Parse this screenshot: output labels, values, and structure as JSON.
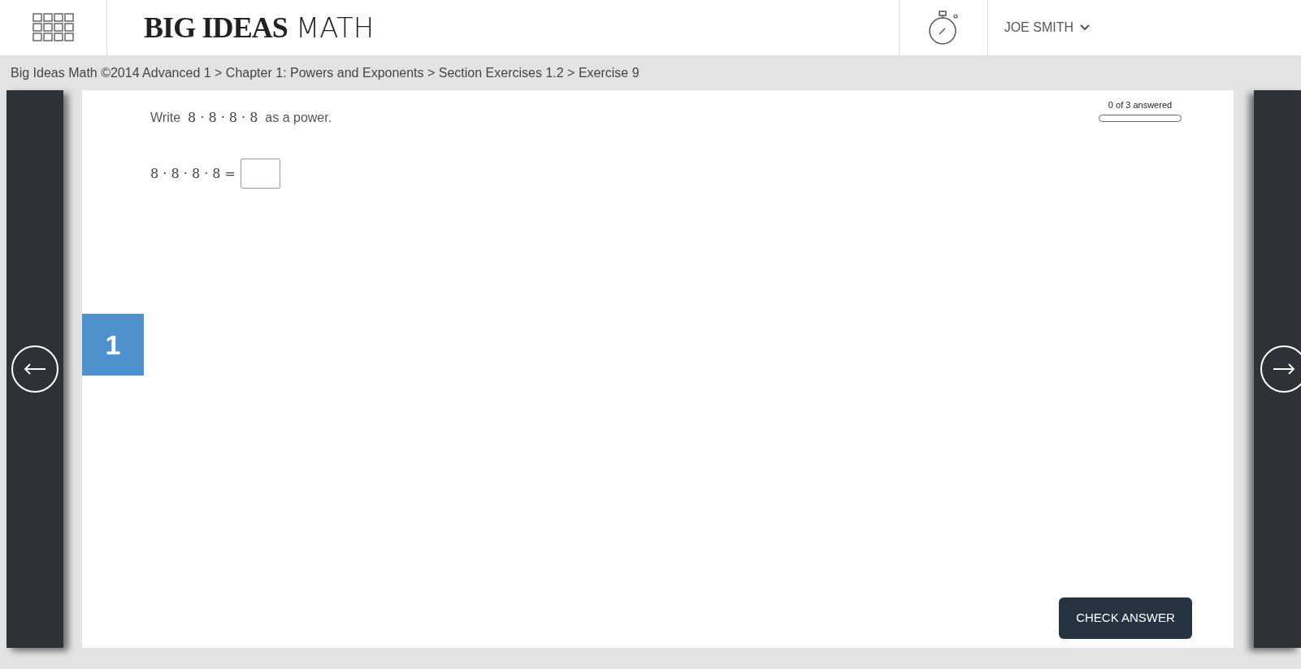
{
  "header": {
    "logo": {
      "bold": "BIG IDEAS",
      "light": "MATH"
    },
    "user": "JOE SMITH"
  },
  "breadcrumb": "Big Ideas Math ©2014 Advanced 1 > Chapter 1: Powers and Exponents > Section Exercises 1.2 > Exercise 9",
  "question": {
    "number": "1",
    "prompt_before": "Write",
    "expression": "8 · 8 · 8 · 8",
    "prompt_after": "as a power.",
    "equation": "8 · 8 · 8 · 8 ="
  },
  "progress": {
    "label": "0 of 3 answered",
    "level": 0
  },
  "check_button": "CHECK ANSWER"
}
